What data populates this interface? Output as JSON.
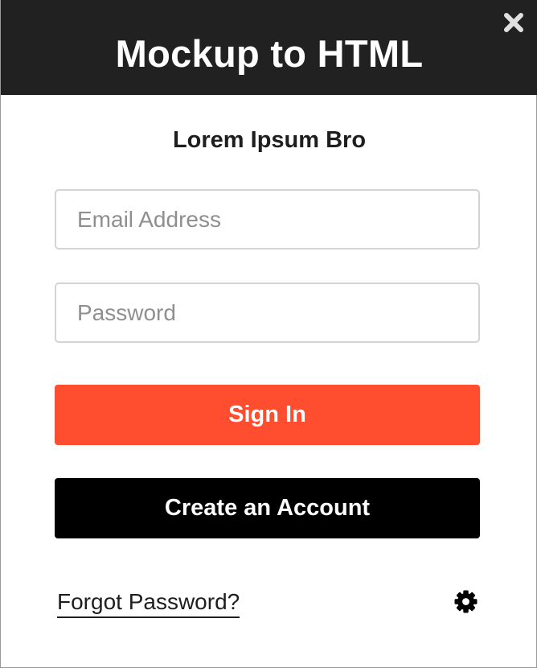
{
  "header": {
    "title": "Mockup to HTML"
  },
  "form": {
    "subtitle": "Lorem Ipsum Bro",
    "email": {
      "placeholder": "Email Address",
      "value": ""
    },
    "password": {
      "placeholder": "Password",
      "value": ""
    },
    "sign_in_label": "Sign In",
    "create_account_label": "Create an Account",
    "forgot_password_label": "Forgot Password?"
  },
  "icons": {
    "close": "close-icon",
    "settings": "gear-icon"
  },
  "colors": {
    "header_bg": "#212121",
    "primary": "#ff4d30",
    "secondary": "#000000"
  }
}
